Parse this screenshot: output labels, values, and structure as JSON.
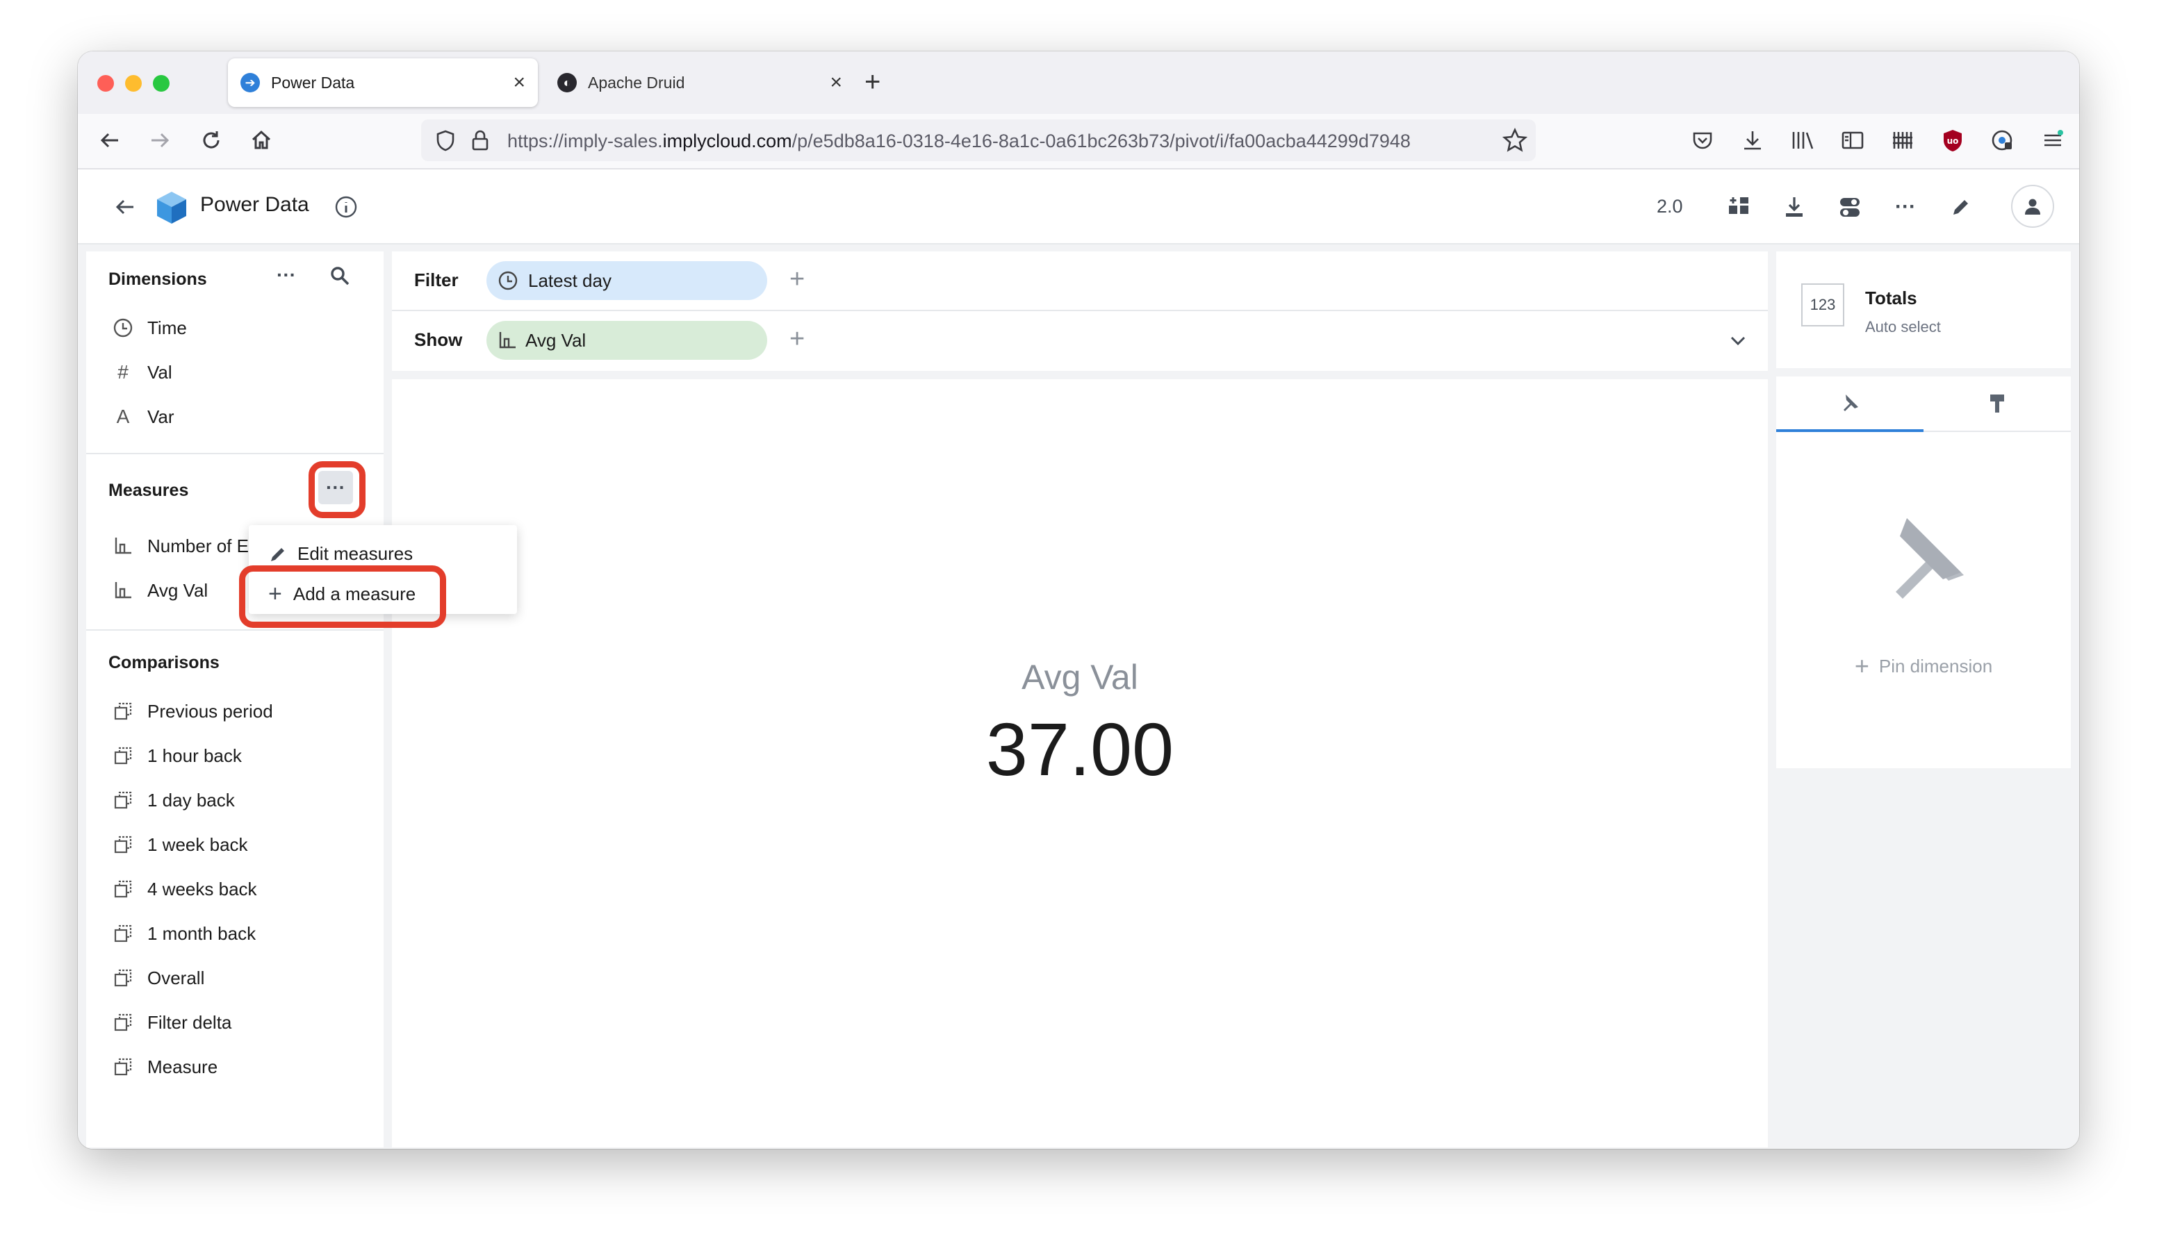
{
  "browser": {
    "tabs": [
      {
        "title": "Power Data",
        "active": true
      },
      {
        "title": "Apache Druid",
        "active": false
      }
    ],
    "url_prefix": "https://imply-sales.",
    "url_domain": "implycloud.com",
    "url_path": "/p/e5db8a16-0318-4e16-8a1c-0a61bc263b73/pivot/i/fa00acba44299d7948"
  },
  "app": {
    "title": "Power Data",
    "version": "2.0"
  },
  "dimensions": {
    "header": "Dimensions",
    "items": [
      {
        "label": "Time",
        "icon": "clock-icon"
      },
      {
        "label": "Val",
        "icon": "hash-icon"
      },
      {
        "label": "Var",
        "icon": "string-icon"
      }
    ]
  },
  "measures": {
    "header": "Measures",
    "items": [
      {
        "label": "Number of E",
        "icon": "measure-icon"
      },
      {
        "label": "Avg Val",
        "icon": "measure-icon"
      }
    ]
  },
  "measures_menu": {
    "edit": "Edit measures",
    "add": "Add a measure"
  },
  "comparisons": {
    "header": "Comparisons",
    "items": [
      {
        "label": "Previous period"
      },
      {
        "label": "1 hour back"
      },
      {
        "label": "1 day back"
      },
      {
        "label": "1 week back"
      },
      {
        "label": "4 weeks back"
      },
      {
        "label": "1 month back"
      },
      {
        "label": "Overall"
      },
      {
        "label": "Filter delta"
      },
      {
        "label": "Measure"
      }
    ]
  },
  "filter": {
    "label": "Filter",
    "pill": "Latest day"
  },
  "show": {
    "label": "Show",
    "pill": "Avg Val"
  },
  "main": {
    "measure_name": "Avg Val",
    "measure_value": "37.00"
  },
  "right": {
    "viz_badge": "123",
    "viz_title": "Totals",
    "viz_subtitle": "Auto select",
    "pin_label": "Pin dimension"
  },
  "colors": {
    "filter_pill": "#d7e9fb",
    "show_pill": "#d8ecd8",
    "highlight": "#e33d2b"
  }
}
